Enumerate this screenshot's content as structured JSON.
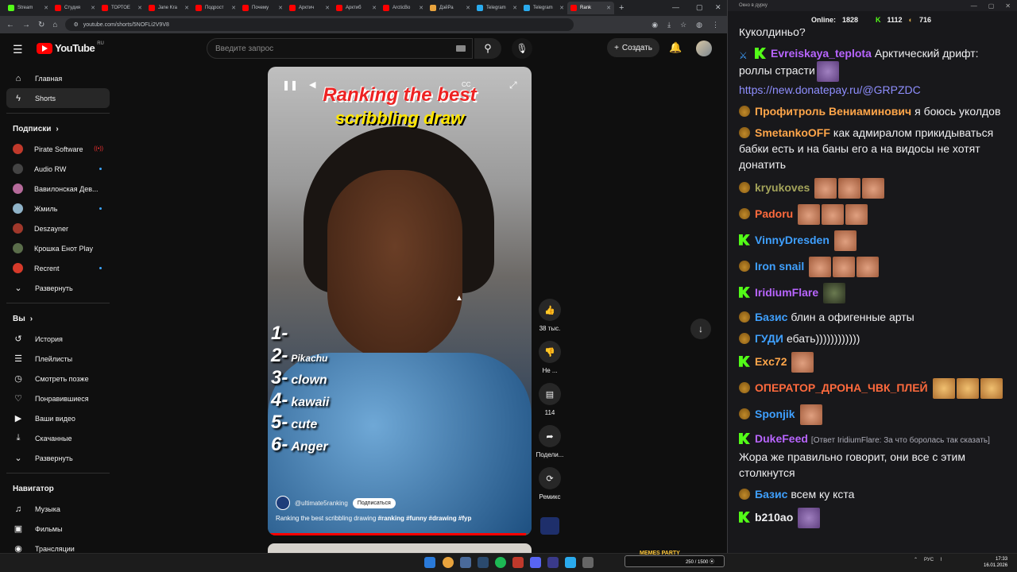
{
  "browser": {
    "tabs": [
      {
        "label": "Stream",
        "color": "#53fc18"
      },
      {
        "label": "Студия",
        "color": "#ff0000"
      },
      {
        "label": "ТОРТОЕ",
        "color": "#ff0000"
      },
      {
        "label": "Jane Kra",
        "color": "#ff0000"
      },
      {
        "label": "Подрост",
        "color": "#ff0000"
      },
      {
        "label": "Почему",
        "color": "#ff0000"
      },
      {
        "label": "Арктич",
        "color": "#ff0000"
      },
      {
        "label": "Арктиб",
        "color": "#ff0000"
      },
      {
        "label": "ArcticBo",
        "color": "#ff0000"
      },
      {
        "label": "ДэйРа",
        "color": "#e8a33d"
      },
      {
        "label": "Telegram",
        "color": "#2aabee"
      },
      {
        "label": "Telegram",
        "color": "#2aabee"
      },
      {
        "label": "Rank",
        "color": "#ff0000"
      }
    ],
    "url": "youtube.com/shorts/5NOFLi2V9V8"
  },
  "youtube": {
    "logo_text": "YouTube",
    "region": "RU",
    "search_placeholder": "Введите запрос",
    "create_label": "Создать",
    "nav": [
      {
        "label": "Главная",
        "icon": "⌂"
      },
      {
        "label": "Shorts",
        "icon": "ϟ"
      }
    ],
    "subs_header": "Подписки",
    "subscriptions": [
      {
        "label": "Pirate Software",
        "color": "#c0392b",
        "indicator": "live"
      },
      {
        "label": "Audio RW",
        "color": "#444",
        "indicator": "dot"
      },
      {
        "label": "Вавилонская Дев...",
        "color": "#b56a9a",
        "indicator": ""
      },
      {
        "label": "Жмиль",
        "color": "#8fb3c8",
        "indicator": "dot"
      },
      {
        "label": "Deszayner",
        "color": "#a0382b",
        "indicator": ""
      },
      {
        "label": "Крошка Енот Play",
        "color": "#5a6d4a",
        "indicator": ""
      },
      {
        "label": "Recrent",
        "color": "#d63a2a",
        "indicator": "dot"
      },
      {
        "label": "Развернуть",
        "color": "",
        "indicator": ""
      }
    ],
    "you_header": "Вы",
    "you_items": [
      {
        "label": "История",
        "icon": "↺"
      },
      {
        "label": "Плейлисты",
        "icon": "☰"
      },
      {
        "label": "Смотреть позже",
        "icon": "◷"
      },
      {
        "label": "Понравившиеся",
        "icon": "♡"
      },
      {
        "label": "Ваши видео",
        "icon": "▶"
      },
      {
        "label": "Скачанные",
        "icon": "⤓"
      },
      {
        "label": "Развернуть",
        "icon": "⌄"
      }
    ],
    "nav_header": "Навигатор",
    "navigator": [
      {
        "label": "Музыка",
        "icon": "♫"
      },
      {
        "label": "Фильмы",
        "icon": "▣"
      },
      {
        "label": "Трансляции",
        "icon": "◉"
      }
    ]
  },
  "short": {
    "title_line1": "Ranking the best",
    "title_line2": "scribbling draw",
    "ranking": [
      {
        "n": "1-",
        "t": ""
      },
      {
        "n": "2-",
        "t": "Pikachu"
      },
      {
        "n": "3-",
        "t": "clown"
      },
      {
        "n": "4-",
        "t": "kawaii"
      },
      {
        "n": "5-",
        "t": "cute"
      },
      {
        "n": "6-",
        "t": "Anger"
      }
    ],
    "channel": "@ultimate5ranking",
    "subscribe_label": "Подписаться",
    "description_text": "Ranking the best scribbling drawing",
    "hashtags": "#ranking #funny #drawing #fyp",
    "likes": "38 тыс.",
    "dislike": "Не ...",
    "comments": "114",
    "share": "Подели...",
    "remix": "Ремикс",
    "progress": 0.98
  },
  "chat": {
    "window_title": "Окно в дурку",
    "online_label": "Online:",
    "online": "1828",
    "kick_count": "1112",
    "coin_count": "716",
    "messages": [
      {
        "user": "",
        "color": "#efeff1",
        "badge": "",
        "text": "знаменитого футболиста, золотой мяч выиграл - Куколдиньо?",
        "emotes": []
      },
      {
        "user": "Evreiskaya_teplota",
        "color": "#b865ff",
        "badge": "sword+kick",
        "text": "Арктический дрифт: роллы страсти",
        "emotes": [
          "p"
        ],
        "link": "https://new.donatepay.ru/@GRPZDC"
      },
      {
        "user": "Профитроль Вениаминович",
        "color": "#ffa64a",
        "badge": "bird",
        "text": "я боюсь уколдов",
        "emotes": []
      },
      {
        "user": "SmetankoOFF",
        "color": "#ffa64a",
        "badge": "bird",
        "text": "как адмиралом прикидываться бабки есть и на баны его а на видосы не хотят донатить",
        "emotes": []
      },
      {
        "user": "kryukoves",
        "color": "#a3a35a",
        "badge": "bird",
        "text": "",
        "emotes": [
          "f",
          "f",
          "f"
        ]
      },
      {
        "user": "Padoru",
        "color": "#ff6a3d",
        "badge": "bird",
        "text": "",
        "emotes": [
          "f",
          "f",
          "f"
        ]
      },
      {
        "user": "VinnyDresden",
        "color": "#3fa0ff",
        "badge": "kick",
        "text": "",
        "emotes": [
          "f"
        ]
      },
      {
        "user": "Iron snail",
        "color": "#3fa0ff",
        "badge": "bird",
        "text": "",
        "emotes": [
          "f",
          "f",
          "f"
        ]
      },
      {
        "user": "IridiumFlare",
        "color": "#b865ff",
        "badge": "kick",
        "text": "",
        "emotes": [
          "g"
        ]
      },
      {
        "user": "Базис",
        "color": "#3fa0ff",
        "badge": "bird",
        "text": "блин а офигенные арты",
        "emotes": []
      },
      {
        "user": "ГУДИ",
        "color": "#3fa0ff",
        "badge": "bird",
        "text": "ебать))))))))))))",
        "emotes": []
      },
      {
        "user": "Exc72",
        "color": "#ffa64a",
        "badge": "kick",
        "text": "",
        "emotes": [
          "f"
        ]
      },
      {
        "user": "ОПЕРАТОР_ДРОНА_ЧВК_ПЛЕЙ",
        "color": "#ff6a3d",
        "badge": "bird",
        "text": "",
        "emotes": [
          "y",
          "y",
          "y"
        ]
      },
      {
        "user": "Sponjik",
        "color": "#3fa0ff",
        "badge": "bird",
        "text": "",
        "emotes": [
          "f"
        ]
      },
      {
        "user": "DukeFeed",
        "color": "#b865ff",
        "badge": "kick",
        "reply": "[Ответ IridiumFlare: За что боролась так сказать]",
        "text": "Жора же правильно говорит, они все с этим столкнутся",
        "emotes": []
      },
      {
        "user": "Базис",
        "color": "#3fa0ff",
        "badge": "bird",
        "text": "всем ку кста",
        "emotes": []
      },
      {
        "user": "b210ao",
        "color": "#efeff1",
        "badge": "kick",
        "text": "",
        "emotes": [
          "p"
        ]
      }
    ]
  },
  "taskbar": {
    "widget_title": "MEMES PARTY",
    "widget_text": "250 / 1500 ⦿",
    "lang": "РУС",
    "time": "17:33",
    "date": "16.01.2026"
  }
}
